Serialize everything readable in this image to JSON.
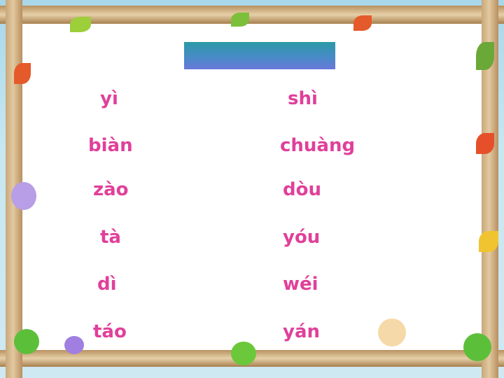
{
  "box_glyph": "",
  "left_column": [
    {
      "pinyin": "yì",
      "chars": "",
      "chars_after": ""
    },
    {
      "pinyin": "biàn",
      "chars": ""
    },
    {
      "pinyin": "zào",
      "chars": ""
    },
    {
      "pinyin": "tà",
      "chars": ""
    },
    {
      "pinyin": "dì",
      "chars": ""
    },
    {
      "pinyin": "táo",
      "chars": ""
    }
  ],
  "right_column": [
    {
      "pinyin": "shì",
      "chars": ""
    },
    {
      "pinyin": "chuàng",
      "chars": ""
    },
    {
      "pinyin": "dòu",
      "chars": ""
    },
    {
      "pinyin": "yóu",
      "chars": ""
    },
    {
      "pinyin": "wéi",
      "chars": ""
    },
    {
      "pinyin": "yán",
      "chars": ""
    }
  ],
  "colors": {
    "pinyin": "#e0409a",
    "chars": "#2a6bc7",
    "title_bar": "#2a9aa6"
  }
}
